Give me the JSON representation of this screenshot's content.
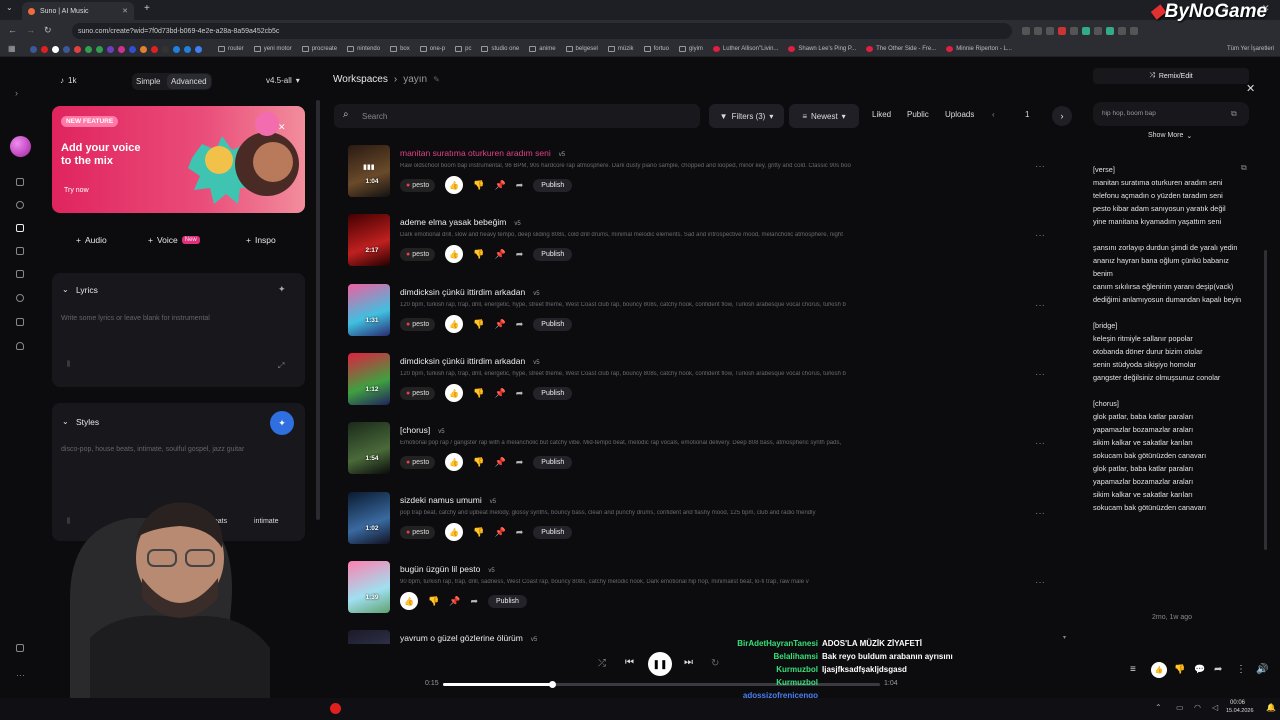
{
  "browser": {
    "tab_title": "Suno | AI Music",
    "url": "suno.com/create?wid=7f0d73bd-b069-4e2e-a28a-8a59a452cb5c",
    "bookmarks": [
      "router",
      "yeni motor",
      "procreate",
      "nintendo",
      "box",
      "one-p",
      "pc",
      "studio one",
      "anime",
      "belgesel",
      "müzik",
      "fortuo",
      "giyim",
      "Luther Allison\"Livin...",
      "Shawn Lee's Ping P...",
      "The Other Side - Fre...",
      "Minnie Riperton - L..."
    ],
    "bookmarks_more": "Tüm Yer İşaretleri"
  },
  "watermark": "ByNoGame",
  "create": {
    "credits": "1k",
    "mode_simple": "Simple",
    "mode_advanced": "Advanced",
    "model": "v4.5-all",
    "banner": {
      "pill": "NEW FEATURE",
      "title": "Add your voice to the mix",
      "cta": "Try now"
    },
    "buttons": {
      "audio": "Audio",
      "voice": "Voice",
      "voice_badge": "New",
      "inspo": "Inspo"
    },
    "lyrics_label": "Lyrics",
    "lyrics_placeholder": "Write some lyrics or leave blank for instrumental",
    "styles_label": "Styles",
    "styles_placeholder": "disco-pop, house beats, intimate, soulful gospel, jazz guitar",
    "style_chips": [
      "beats",
      "intimate"
    ]
  },
  "workspace": {
    "crumb_root": "Workspaces",
    "crumb_current": "yayın",
    "search_placeholder": "Search",
    "filters": "Filters (3)",
    "sort": "Newest",
    "liked": "Liked",
    "public": "Public",
    "uploads": "Uploads",
    "page": "1"
  },
  "songs": [
    {
      "title": "manitan suratıma oturkuren aradım seni",
      "version": "v5",
      "duration": "1:04",
      "tag": "pesto",
      "publish": "Publish",
      "desc": "Raw oldschool boom bap instrumental, 96 BPM, 90s hardcore rap atmosphere. Dark dusty piano sample, chopped and looped, minor key, gritty and cold. Classic 90s boo",
      "highlight": true
    },
    {
      "title": "ademe elma yasak bebeğim",
      "version": "v5",
      "duration": "2:17",
      "tag": "pesto",
      "publish": "Publish",
      "desc": "Dark emotional drill, slow and heavy tempo, deep sliding 808s, cold drill drums, minimal melodic elements. Sad and introspective mood, melancholic atmosphere, night"
    },
    {
      "title": "dimdicksin çünkü ittirdim arkadan",
      "version": "v5",
      "duration": "1:31",
      "tag": "pesto",
      "publish": "Publish",
      "desc": "120 bpm, turkish rap, trap, drill, energetic, hype, street theme, West Coast club rap, bouncy 808s, catchy hook, confident flow, Turkish arabesque vocal chorus, turkish b"
    },
    {
      "title": "dimdicksin çünkü ittirdim arkadan",
      "version": "v5",
      "duration": "1:12",
      "tag": "pesto",
      "publish": "Publish",
      "desc": "120 bpm, turkish rap, trap, drill, energetic, hype, street theme, West Coast club rap, bouncy 808s, catchy hook, confident flow, Turkish arabesque vocal chorus, turkish b"
    },
    {
      "title": "[chorus]",
      "version": "v5",
      "duration": "1:54",
      "tag": "pesto",
      "publish": "Publish",
      "desc": "Emotional pop rap / gangster rap with a melancholic but catchy vibe. Mid-tempo beat, melodic rap vocals, emotional delivery. Deep 808 bass, atmospheric synth pads,"
    },
    {
      "title": "sizdeki namus umumi",
      "version": "v5",
      "duration": "1:02",
      "tag": "pesto",
      "publish": "Publish",
      "desc": "pop trap beat, catchy and upbeat melody, glossy synths, bouncy bass, clean and punchy drums, confident and flashy mood, 125 bpm, club and radio friendly"
    },
    {
      "title": "bugün üzgün lil pesto",
      "version": "v5",
      "duration": "1:39",
      "tag": "",
      "publish": "Publish",
      "desc": "90 bpm, turkish rap, trap, drill, sadness, West Coast rap, bouncy 808s, catchy melodic hook, Dark emotional hip hop, minimalist beat, lo-fi trap, raw male v"
    },
    {
      "title": "yavrum o güzel gözlerine ölürüm",
      "version": "v5",
      "duration": "",
      "tag": "",
      "publish": "",
      "desc": ""
    }
  ],
  "detail": {
    "remix": "Remix/Edit",
    "tags": "hip hop, boom bap",
    "show_more": "Show More",
    "lyrics": "[verse]\nmanitan suratıma oturkuren aradım seni\ntelefonu açmadın o yüzden taradım seni\npesto kibar adam sanıyosun yaratık değil\nyine manitana kıyamadım yaşattım seni\n\nşansını zorlayıp durdun şimdi de yaralı yedin\nananız hayran bana oğlum çünkü babanız benim\ncanım sıkılırsa eğlenirim yaranı deşip(vack)\ndediğimi anlamıyosun dumandan kapalı beyin\n\n[bridge]\nkeleşin ritmiyle sallanır popolar\notobanda döner durur bizim otolar\nsenin stüdyoda sikişiyo homolar\ngangster değilsiniz olmuşsunuz conolar\n\n[chorus]\nglok patlar, baba katlar paraları\nyapamazlar bozamazlar araları\nsikim kalkar ve sakatlar karıları\nsokucam bak götünüzden canavarı\nglok patlar, baba katlar paraları\nyapamazlar bozamazlar araları\nsikim kalkar ve sakatlar karıları\nsokucam bak götünüzden canavarı",
    "timestamp": "2mo, 1w ago"
  },
  "player": {
    "elapsed": "0:15",
    "total": "1:04",
    "progress": 0.25
  },
  "chat": [
    {
      "user": "BirAdetHayranTanesi",
      "msg": "ADOS'LA MÜZİK ZİYAFETİ",
      "color": "#38e07a"
    },
    {
      "user": "Belalihamsi",
      "msg": "Bak reyo buldum arabanın ayrısını",
      "color": "#38e07a"
    },
    {
      "user": "Kurmuzbol",
      "msg": "Ijasjfksadfşakljdsgasd",
      "color": "#38e07a"
    },
    {
      "user": "Kurmuzbol",
      "msg": "",
      "color": "#38e07a"
    },
    {
      "user": "adossizofrenicengo",
      "msg": "",
      "color": "#4a7ff0"
    },
    {
      "user": "adossizofrenicengo",
      "msg": "",
      "color": "#4a7ff0"
    }
  ],
  "taskbar": {
    "time": "00:06",
    "date": "15.04.2026"
  }
}
